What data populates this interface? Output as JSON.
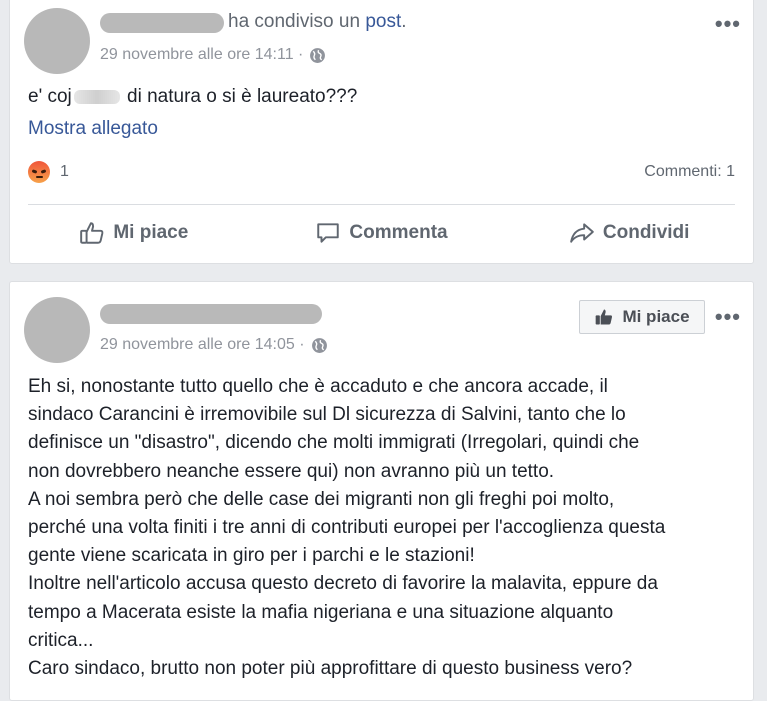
{
  "post1": {
    "shared_prefix": "ha condiviso un ",
    "shared_link": "post",
    "shared_suffix": ".",
    "timestamp": "29 novembre alle ore 14:11 ·",
    "text_before": "e' coj",
    "text_after": " di natura o si è laureato???",
    "show_attachment": "Mostra allegato",
    "reaction_count": "1",
    "comments": "Commenti: 1",
    "actions": {
      "like": "Mi piace",
      "comment": "Commenta",
      "share": "Condividi"
    },
    "more": "•••"
  },
  "post2": {
    "timestamp": "29 novembre alle ore 14:05 ·",
    "like_page_button": "Mi piace",
    "more": "•••",
    "lines": [
      "Eh si, nonostante tutto quello che è accaduto e che ancora accade, il",
      "sindaco Carancini è irremovibile sul Dl sicurezza di Salvini, tanto che lo",
      "definisce un \"disastro\", dicendo che molti immigrati (Irregolari, quindi che",
      "non dovrebbero neanche essere qui) non avranno più un tetto.",
      "A noi sembra però che delle case dei migranti non gli freghi poi molto,",
      "perché una volta finiti i tre anni di contributi europei per l'accoglienza questa",
      "gente viene scaricata in giro per i parchi e le stazioni!",
      "Inoltre nell'articolo accusa questo decreto di favorire la malavita, eppure da",
      "tempo a Macerata esiste la mafia nigeriana e una situazione alquanto",
      "critica...",
      "Caro sindaco, brutto non poter più approfittare di questo business vero?"
    ]
  },
  "icons": [
    "globe-icon",
    "angry-reaction-icon",
    "thumbs-up-icon",
    "comment-icon",
    "share-icon",
    "more-options-icon"
  ],
  "colors": {
    "link": "#385898",
    "muted": "#90949c",
    "text": "#1d2129",
    "background": "#e9ebee"
  }
}
